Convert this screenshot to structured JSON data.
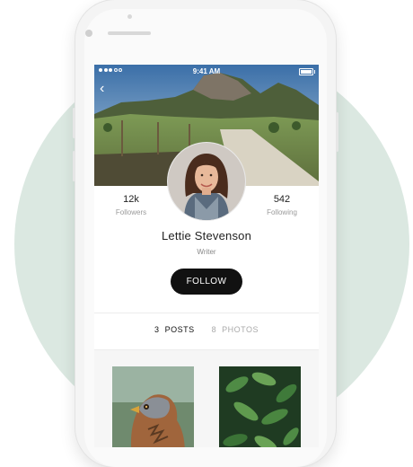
{
  "statusbar": {
    "time": "9:41 AM"
  },
  "profile": {
    "name": "Lettie Stevenson",
    "role": "Writer",
    "followers_count": "12k",
    "followers_label": "Followers",
    "following_count": "542",
    "following_label": "Following",
    "follow_button": "FOLLOW"
  },
  "tabs": {
    "posts_count": "3",
    "posts_label": "POSTS",
    "photos_count": "8",
    "photos_label": "PHOTOS"
  },
  "icons": [
    "back-chevron-icon",
    "signal-dots-icon",
    "battery-icon"
  ],
  "colors": {
    "accent": "#111111",
    "background_circle": "#dbe8e1"
  }
}
